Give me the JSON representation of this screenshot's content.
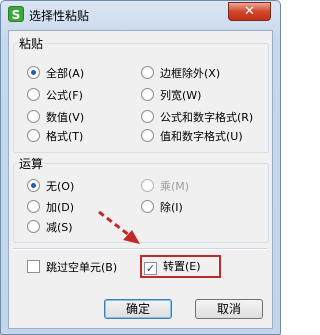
{
  "window": {
    "title": "选择性粘贴",
    "icon_label": "S",
    "close_label": "✕"
  },
  "paste_group": {
    "label": "粘贴",
    "options": [
      {
        "label": "全部(A)",
        "selected": true
      },
      {
        "label": "边框除外(X)",
        "selected": false
      },
      {
        "label": "公式(F)",
        "selected": false
      },
      {
        "label": "列宽(W)",
        "selected": false
      },
      {
        "label": "数值(V)",
        "selected": false
      },
      {
        "label": "公式和数字格式(R)",
        "selected": false
      },
      {
        "label": "格式(T)",
        "selected": false
      },
      {
        "label": "值和数字格式(U)",
        "selected": false
      }
    ]
  },
  "operation_group": {
    "label": "运算",
    "options": [
      {
        "label": "无(O)",
        "selected": true,
        "enabled": true
      },
      {
        "label": "乘(M)",
        "selected": false,
        "enabled": false
      },
      {
        "label": "加(D)",
        "selected": false,
        "enabled": true
      },
      {
        "label": "除(I)",
        "selected": false,
        "enabled": true
      },
      {
        "label": "减(S)",
        "selected": false,
        "enabled": true
      }
    ]
  },
  "checkboxes": {
    "skip_blanks": {
      "label": "跳过空单元(B)",
      "checked": false
    },
    "transpose": {
      "label": "转置(E)",
      "checked": true
    }
  },
  "buttons": {
    "ok": "确定",
    "cancel": "取消"
  },
  "colors": {
    "highlight": "#c32828",
    "arrow": "#c32828"
  }
}
